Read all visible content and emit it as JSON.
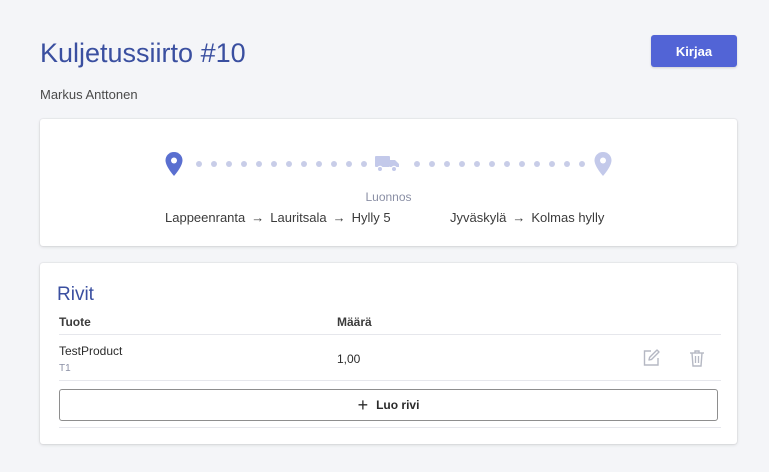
{
  "header": {
    "title": "Kuljetussiirto #10",
    "subtitle": "Markus Anttonen",
    "action_label": "Kirjaa"
  },
  "route": {
    "status": "Luonnos",
    "from": {
      "city": "Lappeenranta",
      "area": "Lauritsala",
      "spot": "Hylly 5"
    },
    "to": {
      "city": "Jyväskylä",
      "spot": "Kolmas hylly"
    },
    "arrow": "→",
    "icons": {
      "start": "map-pin-icon",
      "transit": "truck-icon",
      "end": "map-pin-icon"
    },
    "colors": {
      "start_pin": "#5a6fd0",
      "end_pin": "#c3c9ea",
      "dots": "#c8cde8",
      "truck": "#c3c9ea"
    }
  },
  "rows": {
    "title": "Rivit",
    "columns": {
      "product": "Tuote",
      "quantity": "Määrä"
    },
    "items": [
      {
        "name": "TestProduct",
        "code": "T1",
        "quantity": "1,00"
      }
    ],
    "add_label": "Luo rivi",
    "add_icon": "plus-icon",
    "row_icons": {
      "edit": "edit-icon",
      "delete": "trash-icon"
    }
  },
  "colors": {
    "accent": "#5264d6",
    "title": "#3a4fa0",
    "background": "#f4f5f8"
  }
}
